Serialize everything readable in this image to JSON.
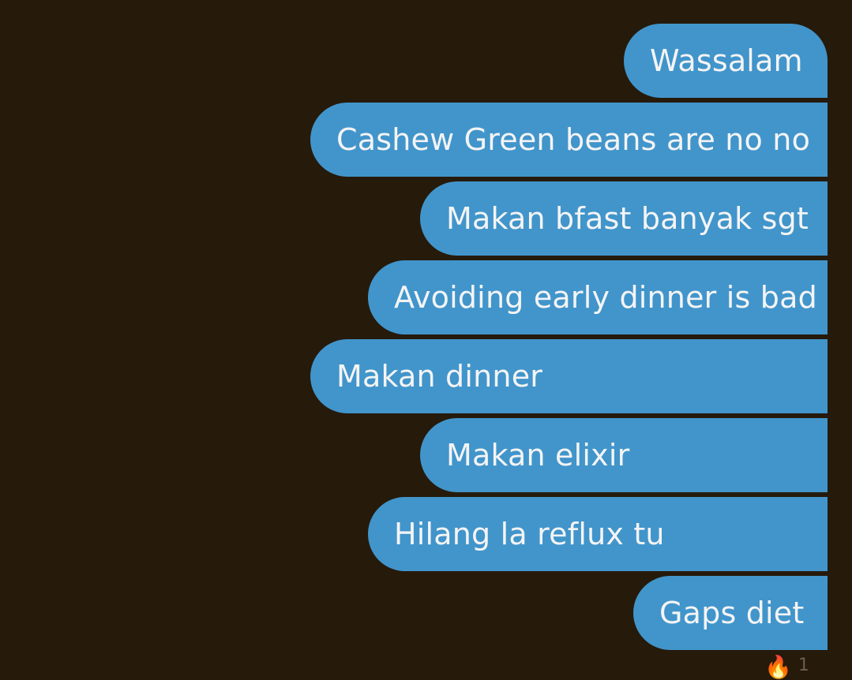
{
  "messages": [
    {
      "text": "Wassalam"
    },
    {
      "text": "Cashew Green beans are no no"
    },
    {
      "text": "Makan bfast banyak sgt"
    },
    {
      "text": "Avoiding early dinner is bad"
    },
    {
      "text": "Makan dinner"
    },
    {
      "text": "Makan elixir"
    },
    {
      "text": "Hilang la reflux tu"
    },
    {
      "text": "Gaps diet"
    }
  ],
  "reaction": {
    "icon": "fire-icon",
    "count": "1"
  },
  "colors": {
    "background": "#261a0b",
    "bubble": "#4195cb",
    "text": "#f4f4f4",
    "reaction": "#f28a1b"
  }
}
